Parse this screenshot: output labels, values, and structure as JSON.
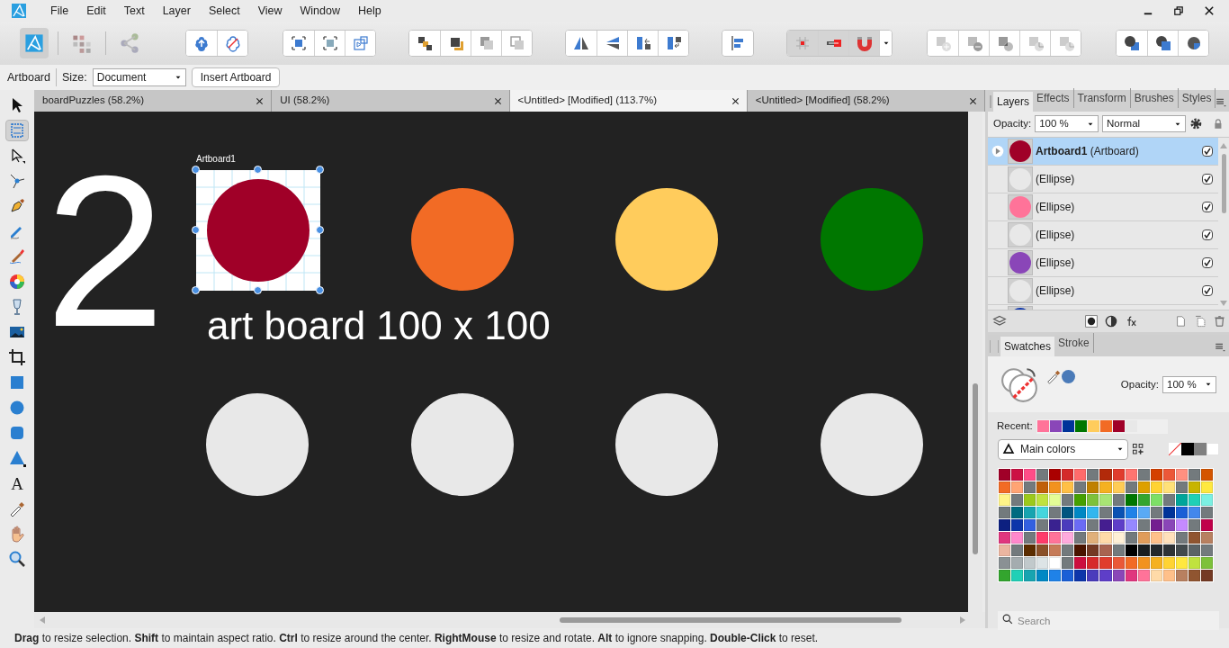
{
  "menu": [
    "File",
    "Edit",
    "Text",
    "Layer",
    "Select",
    "View",
    "Window",
    "Help"
  ],
  "personas": [
    {
      "kind": "designer",
      "selected": true
    },
    {
      "kind": "pixel",
      "selected": false
    },
    {
      "kind": "export",
      "selected": false
    }
  ],
  "context_bar": {
    "tool": "Artboard",
    "size_label": "Size:",
    "size_value": "Document",
    "button": "Insert Artboard"
  },
  "tools": [
    {
      "kind": "move",
      "selected": false
    },
    {
      "kind": "artboard",
      "selected": true
    },
    {
      "kind": "node",
      "selected": false
    },
    {
      "kind": "corner",
      "selected": false
    },
    {
      "kind": "pen",
      "selected": false
    },
    {
      "kind": "pencil",
      "selected": false
    },
    {
      "kind": "brush",
      "selected": false
    },
    {
      "kind": "fill",
      "selected": false
    },
    {
      "kind": "transparency",
      "selected": false
    },
    {
      "kind": "image",
      "selected": false
    },
    {
      "kind": "crop",
      "selected": false
    },
    {
      "kind": "rectangle",
      "selected": false
    },
    {
      "kind": "ellipse",
      "selected": false
    },
    {
      "kind": "rounded",
      "selected": false
    },
    {
      "kind": "triangle",
      "selected": false
    },
    {
      "kind": "text",
      "glyph": "A",
      "selected": false
    },
    {
      "kind": "picker",
      "selected": false
    },
    {
      "kind": "hand",
      "selected": false
    },
    {
      "kind": "zoom",
      "selected": false
    }
  ],
  "doc_tabs": [
    {
      "label": "boardPuzzles (58.2%)",
      "selected": false
    },
    {
      "label": "UI (58.2%)",
      "selected": false
    },
    {
      "label": "<Untitled> [Modified] (113.7%)",
      "selected": true
    },
    {
      "label": "<Untitled> [Modified] (58.2%)",
      "selected": false
    }
  ],
  "canvas": {
    "number": "2",
    "artboard": {
      "label": "Artboard1",
      "color": "#a00028"
    },
    "caption": "art board 100 x 100",
    "shapes": [
      {
        "color": "#f26b25"
      },
      {
        "color": "#ffcc5c"
      },
      {
        "color": "#007700"
      },
      {
        "color": "#e8e8e8"
      },
      {
        "color": "#e8e8e8"
      },
      {
        "color": "#e8e8e8"
      },
      {
        "color": "#e8e8e8"
      }
    ]
  },
  "layers_panel": {
    "tabs": [
      {
        "label": "Layers",
        "selected": true
      },
      {
        "label": "Effects",
        "selected": false
      },
      {
        "label": "Transform",
        "selected": false
      },
      {
        "label": "Brushes",
        "selected": false
      },
      {
        "label": "Styles",
        "selected": false
      }
    ],
    "opacity_label": "Opacity:",
    "opacity": "100 %",
    "blend_mode": "Normal",
    "layers": [
      {
        "name": "**Artboard1** (Artboard)",
        "color": "#a00028",
        "checked": true,
        "selected": true,
        "expandable": true
      },
      {
        "name": "(Ellipse)",
        "color": "#e8e8e8",
        "checked": true,
        "selected": false,
        "expandable": false
      },
      {
        "name": "(Ellipse)",
        "color": "#ff7399",
        "checked": true,
        "selected": false,
        "expandable": false
      },
      {
        "name": "(Ellipse)",
        "color": "#e8e8e8",
        "checked": true,
        "selected": false,
        "expandable": false
      },
      {
        "name": "(Ellipse)",
        "color": "#8a46b8",
        "checked": true,
        "selected": false,
        "expandable": false
      },
      {
        "name": "(Ellipse)",
        "color": "#e8e8e8",
        "checked": true,
        "selected": false,
        "expandable": false
      },
      {
        "color": "#0d35aa",
        "selected": false
      }
    ]
  },
  "swatches_panel": {
    "tabs": [
      {
        "label": "Swatches",
        "selected": true
      },
      {
        "label": "Stroke",
        "selected": false
      }
    ],
    "opacity_label": "Opacity:",
    "opacity": "100 %",
    "recent_label": "Recent:",
    "recent": [
      {
        "color": "#ff7399"
      },
      {
        "color": "#8a46b8"
      },
      {
        "color": "#003399"
      },
      {
        "color": "#007700"
      },
      {
        "color": "#ffcc5c"
      },
      {
        "color": "#f26b25"
      },
      {
        "color": "#a00028"
      },
      {
        "color": "#e8e8e8"
      }
    ],
    "palette": "Main colors",
    "swatches": [
      {
        "color": "#a00028"
      },
      {
        "color": "#cc1144"
      },
      {
        "color": "#ff4d88"
      },
      {
        "color": "#737a7d"
      },
      {
        "color": "#aa0000"
      },
      {
        "color": "#d42a2a"
      },
      {
        "color": "#ff6b6b"
      },
      {
        "color": "#737a7d"
      },
      {
        "color": "#b22a0a"
      },
      {
        "color": "#e03c2d"
      },
      {
        "color": "#ff7570"
      },
      {
        "color": "#737a7d"
      },
      {
        "color": "#d44000"
      },
      {
        "color": "#ec5838"
      },
      {
        "color": "#ff9080"
      },
      {
        "color": "#737a7d"
      },
      {
        "color": "#d45500"
      },
      {
        "color": "#f26b25"
      },
      {
        "color": "#ffa474"
      },
      {
        "color": "#737a7d"
      },
      {
        "color": "#c0600a"
      },
      {
        "color": "#f2921f"
      },
      {
        "color": "#ffc046"
      },
      {
        "color": "#737a7d"
      },
      {
        "color": "#bf8000"
      },
      {
        "color": "#f5b120"
      },
      {
        "color": "#ffcc55"
      },
      {
        "color": "#737a7d"
      },
      {
        "color": "#dda000"
      },
      {
        "color": "#ffd333"
      },
      {
        "color": "#ffe178"
      },
      {
        "color": "#737a7d"
      },
      {
        "color": "#c8b400"
      },
      {
        "color": "#ffe83f"
      },
      {
        "color": "#fff488"
      },
      {
        "color": "#737a7d"
      },
      {
        "color": "#9cc91b"
      },
      {
        "color": "#c0e23f"
      },
      {
        "color": "#e4fd96"
      },
      {
        "color": "#737a7d"
      },
      {
        "color": "#46a000"
      },
      {
        "color": "#7dc13a"
      },
      {
        "color": "#a8e474"
      },
      {
        "color": "#737a7d"
      },
      {
        "color": "#007700"
      },
      {
        "color": "#33a52e"
      },
      {
        "color": "#7ddf66"
      },
      {
        "color": "#737a7d"
      },
      {
        "color": "#00a59a"
      },
      {
        "color": "#20d0b6"
      },
      {
        "color": "#7bf0e2"
      },
      {
        "color": "#737a7d"
      },
      {
        "color": "#006b80"
      },
      {
        "color": "#17a4b0"
      },
      {
        "color": "#44d5dd"
      },
      {
        "color": "#737a7d"
      },
      {
        "color": "#005580"
      },
      {
        "color": "#0088c4"
      },
      {
        "color": "#33b6ee"
      },
      {
        "color": "#737a7d"
      },
      {
        "color": "#0a52b3"
      },
      {
        "color": "#1f82e8"
      },
      {
        "color": "#5aaaf5"
      },
      {
        "color": "#737a7d"
      },
      {
        "color": "#003399"
      },
      {
        "color": "#1a5fd6"
      },
      {
        "color": "#4287ec"
      },
      {
        "color": "#737a7d"
      },
      {
        "color": "#0d2080"
      },
      {
        "color": "#0d35aa"
      },
      {
        "color": "#3360e0"
      },
      {
        "color": "#737a7d"
      },
      {
        "color": "#3a2290"
      },
      {
        "color": "#4a3cbc"
      },
      {
        "color": "#6b6bf5"
      },
      {
        "color": "#737a7d"
      },
      {
        "color": "#451e90"
      },
      {
        "color": "#5e3ec8"
      },
      {
        "color": "#9688ff"
      },
      {
        "color": "#737a7d"
      },
      {
        "color": "#741e90"
      },
      {
        "color": "#8a46b8"
      },
      {
        "color": "#c58aff"
      },
      {
        "color": "#737a7d"
      },
      {
        "color": "#c0004a"
      },
      {
        "color": "#e0367e"
      },
      {
        "color": "#ff88cc"
      },
      {
        "color": "#737a7d"
      },
      {
        "color": "#ff3b6a"
      },
      {
        "color": "#ff7399"
      },
      {
        "color": "#ffaadd"
      },
      {
        "color": "#737a7d"
      },
      {
        "color": "#e0b07a"
      },
      {
        "color": "#ffdaa8"
      },
      {
        "color": "#fff0d6"
      },
      {
        "color": "#737a7d"
      },
      {
        "color": "#e09c5a"
      },
      {
        "color": "#ffc08a"
      },
      {
        "color": "#ffe0bb"
      },
      {
        "color": "#737a7d"
      },
      {
        "color": "#905530"
      },
      {
        "color": "#b88060"
      },
      {
        "color": "#ebb5a0"
      },
      {
        "color": "#737a7d"
      },
      {
        "color": "#5c2d00"
      },
      {
        "color": "#8a5028"
      },
      {
        "color": "#c67b58"
      },
      {
        "color": "#737a7d"
      },
      {
        "color": "#4a1400"
      },
      {
        "color": "#743a24"
      },
      {
        "color": "#a86450"
      },
      {
        "color": "#737a7d"
      },
      {
        "color": "#000000"
      },
      {
        "color": "#191d1f"
      },
      {
        "color": "#24282b"
      },
      {
        "color": "#2e3336"
      },
      {
        "color": "#424a4d"
      },
      {
        "color": "#5b6366"
      },
      {
        "color": "#737a7d"
      },
      {
        "color": "#8a9194"
      },
      {
        "color": "#a4acaf"
      },
      {
        "color": "#c1c9cb"
      },
      {
        "color": "#dde4e6"
      },
      {
        "color": "#ffffff"
      },
      {
        "color": "#737a7d"
      },
      {
        "color": "#cc0e3e"
      },
      {
        "color": "#d62a2a"
      },
      {
        "color": "#e03c2d"
      },
      {
        "color": "#ea5838"
      },
      {
        "color": "#f26b25"
      },
      {
        "color": "#f2921f"
      },
      {
        "color": "#f5b120"
      },
      {
        "color": "#ffd333"
      },
      {
        "color": "#ffe83f"
      },
      {
        "color": "#c0e23f"
      },
      {
        "color": "#7dc13a"
      },
      {
        "color": "#33a52e"
      },
      {
        "color": "#20d0b6"
      },
      {
        "color": "#17a4b0"
      },
      {
        "color": "#0088c4"
      },
      {
        "color": "#1f82e8"
      },
      {
        "color": "#1a5fd6"
      },
      {
        "color": "#0d35aa"
      },
      {
        "color": "#4a3cbc"
      },
      {
        "color": "#5e3ec8"
      },
      {
        "color": "#8a46b8"
      },
      {
        "color": "#e0367e"
      },
      {
        "color": "#ff7399"
      },
      {
        "color": "#ffdaa8"
      },
      {
        "color": "#ffc08a"
      },
      {
        "color": "#b88060"
      },
      {
        "color": "#905530"
      },
      {
        "color": "#743a24"
      }
    ],
    "search_placeholder": "Search"
  },
  "status_bar": "**Drag** to resize selection. **Shift** to maintain aspect ratio. **Ctrl** to resize around the center. **RightMouse** to resize and rotate. **Alt** to ignore snapping. **Double-Click** to reset."
}
